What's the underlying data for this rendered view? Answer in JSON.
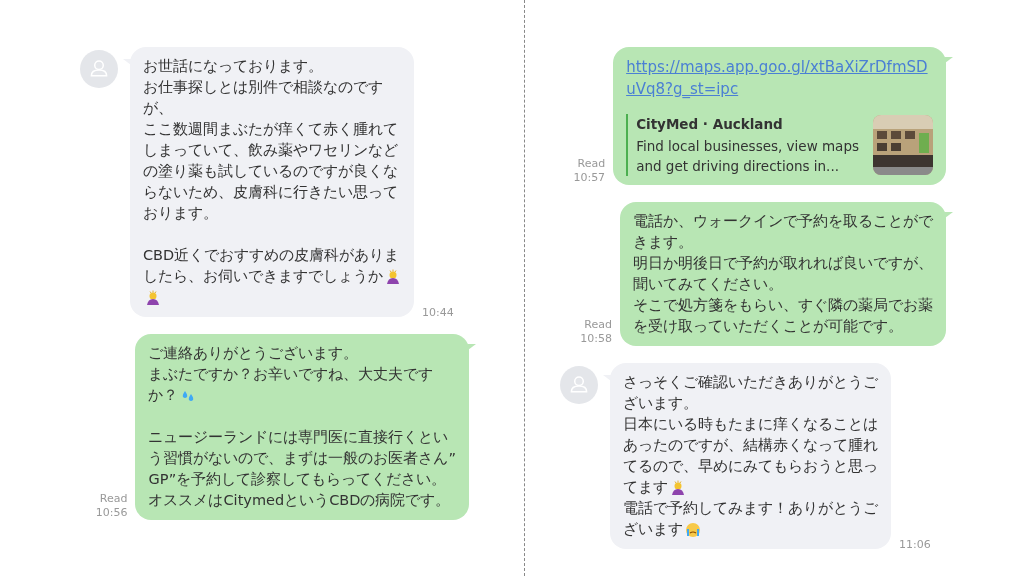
{
  "columns": [
    {
      "messages": [
        {
          "kind": "received",
          "time": "10:44",
          "paragraphs": [
            [
              {
                "text": "お世話になっております。"
              },
              {
                "text": "お仕事探しとは別件で相談なのです"
              },
              {
                "text": "が、"
              },
              {
                "text": "ここ数週間まぶたが痒くて赤く腫れて"
              },
              {
                "text": "しまっていて、飲み薬やワセリンなど"
              },
              {
                "text": "の塗り薬も試しているのですが良くな"
              },
              {
                "text": "らないため、皮膚科に行きたい思って"
              },
              {
                "text": "おります。"
              }
            ],
            [
              {
                "text": "CBD近くでおすすめの皮膚科がありま"
              },
              {
                "text": "したら、お伺いできますでしょうか",
                "kind": "bow"
              },
              {
                "kind": "bow"
              }
            ]
          ]
        },
        {
          "kind": "sent",
          "read": "Read",
          "time": "10:56",
          "paragraphs": [
            [
              {
                "text": "ご連絡ありがとうございます。"
              },
              {
                "text": "まぶたですか？お辛いですね、大丈夫です"
              },
              {
                "text": "か？",
                "kind": "sweat"
              }
            ],
            [
              {
                "text": "ニュージーランドには専門医に直接行くとい"
              },
              {
                "text": "う習慣がないので、まずは一般のお医者さん”"
              },
              {
                "text": "GP”を予約して診察してもらってください。"
              },
              {
                "text": "オススメはCitymedというCBDの病院です。"
              }
            ]
          ]
        }
      ]
    },
    {
      "messages": [
        {
          "kind": "link",
          "read": "Read",
          "time": "10:57",
          "link_lines": [
            "https://maps.app.goo.gl/xtBaXiZrDfmSD",
            "uVq8?g_st=ipc"
          ],
          "preview": {
            "title": "CityMed · Auckland",
            "description_lines": [
              "Find local businesses, view maps",
              "and get driving directions in..."
            ]
          }
        },
        {
          "kind": "sent",
          "read": "Read",
          "time": "10:58",
          "paragraphs": [
            [
              {
                "text": "電話か、ウォークインで予約を取ることがで"
              },
              {
                "text": "きます。"
              },
              {
                "text": "明日か明後日で予約が取れれば良いですが、"
              },
              {
                "text": "聞いてみてください。"
              },
              {
                "text": "そこで処方箋をもらい、すぐ隣の薬局でお薬"
              },
              {
                "text": "を受け取っていただくことが可能です。"
              }
            ]
          ]
        },
        {
          "kind": "received",
          "time": "11:06",
          "paragraphs": [
            [
              {
                "text": "さっそくご確認いただきありがとうご"
              },
              {
                "text": "ざいます。"
              },
              {
                "text": "日本にいる時もたまに痒くなることは"
              },
              {
                "text": "あったのですが、結構赤くなって腫れ"
              },
              {
                "text": "てるので、早めにみてもらおうと思っ"
              },
              {
                "text": "てます",
                "kind": "bow"
              },
              {
                "text": "電話で予約してみます！ありがとうご"
              },
              {
                "text": "ざいます",
                "kind": "crying"
              }
            ]
          ]
        }
      ]
    }
  ]
}
